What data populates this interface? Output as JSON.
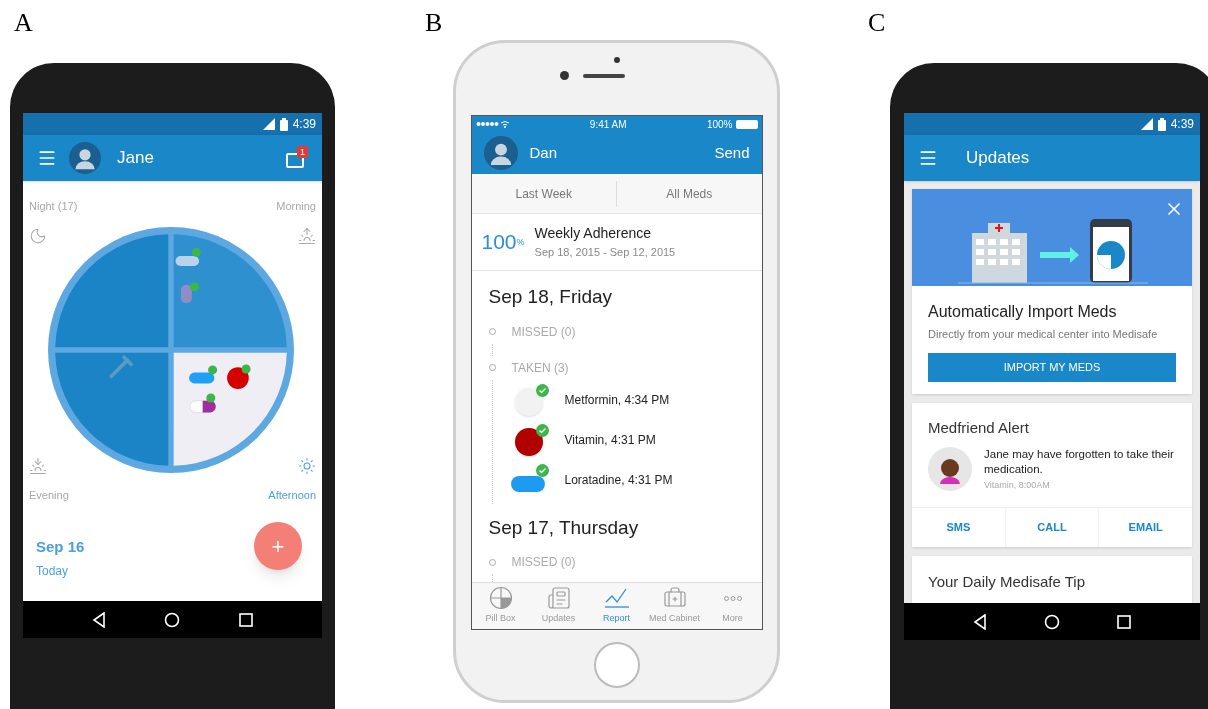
{
  "phone_a": {
    "label": "A",
    "status_time": "4:39",
    "app_bar": {
      "title": "Jane",
      "badge": "1"
    },
    "periods": [
      {
        "name": "Night (17)",
        "selected": false
      },
      {
        "name": "Morning",
        "selected": false
      },
      {
        "name": "Evening",
        "selected": false
      },
      {
        "name": "Afternoon",
        "selected": true
      }
    ],
    "date": "Sep 16",
    "date_caption": "Today",
    "fab": "+"
  },
  "phone_b": {
    "label": "B",
    "status": {
      "time": "9:41 AM",
      "battery": "100%"
    },
    "nav": {
      "title": "Dan",
      "action": "Send"
    },
    "segments": [
      "Last Week",
      "All Meds"
    ],
    "adherence": {
      "value": "100",
      "unit": "%",
      "title": "Weekly Adherence",
      "range": "Sep 18, 2015 - Sep 12, 2015"
    },
    "days": [
      {
        "title": "Sep 18, Friday",
        "groups": [
          {
            "heading": "MISSED (0)"
          },
          {
            "heading": "TAKEN (3)",
            "items": [
              {
                "text": "Metformin, 4:34 PM",
                "kind": "round",
                "color": "#f2f2f2"
              },
              {
                "text": "Vitamin, 4:31 PM",
                "kind": "round",
                "color": "#b00000"
              },
              {
                "text": "Loratadine, 4:31 PM",
                "kind": "capsule",
                "color": "#1e9bf0"
              }
            ]
          }
        ]
      },
      {
        "title": "Sep 17, Thursday",
        "groups": [
          {
            "heading": "MISSED (0)"
          }
        ]
      }
    ],
    "tabs": [
      {
        "label": "Pill Box",
        "selected": false
      },
      {
        "label": "Updates",
        "selected": false
      },
      {
        "label": "Report",
        "selected": true
      },
      {
        "label": "Med Cabinet",
        "selected": false
      },
      {
        "label": "More",
        "selected": false
      }
    ]
  },
  "phone_c": {
    "label": "C",
    "status_time": "4:39",
    "app_bar": {
      "title": "Updates"
    },
    "import_card": {
      "title": "Automatically Import Meds",
      "subtitle": "Directly from your medical center into Medisafe",
      "button": "IMPORT MY MEDS"
    },
    "alert_card": {
      "title": "Medfriend Alert",
      "message": "Jane may have forgotten to take their medication.",
      "detail": "Vitamin, 8:00AM",
      "actions": [
        "SMS",
        "CALL",
        "EMAIL"
      ]
    },
    "tip_card": {
      "title": "Your Daily Medisafe Tip"
    }
  }
}
